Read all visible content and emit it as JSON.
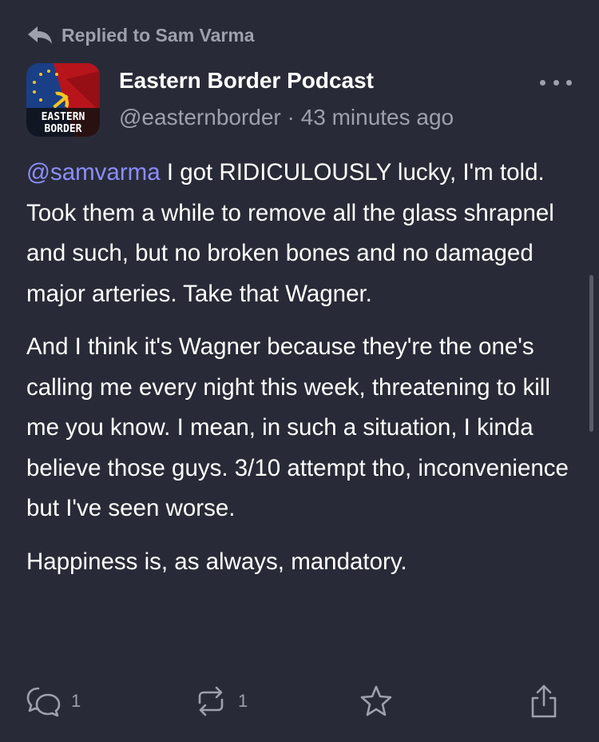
{
  "reply_context": {
    "icon": "reply-arrow-icon",
    "text": "Replied to Sam Varma"
  },
  "author": {
    "display_name": "Eastern Border Podcast",
    "handle": "@easternborder",
    "separator": "·",
    "time_ago": "43 minutes ago",
    "avatar_text_line1": "EASTERN",
    "avatar_text_line2": "BORDER"
  },
  "post": {
    "mention": "@samvarma",
    "paragraph1_rest": " I got RIDICULOUSLY lucky, I'm told. Took them a while to remove all the glass shrapnel and such, but no broken bones and no damaged major arteries. Take that Wagner.",
    "paragraph2": "And I think it's Wagner because they're the one's calling me every night this week, threatening to kill me you know. I mean, in such a situation, I kinda believe those guys. 3/10 attempt tho, inconvenience but I've seen worse.",
    "paragraph3": "Happiness is, as always, mandatory."
  },
  "actions": {
    "reply": {
      "icon": "reply-bubble-icon",
      "count": "1"
    },
    "boost": {
      "icon": "boost-icon",
      "count": "1"
    },
    "favourite": {
      "icon": "star-icon"
    },
    "share": {
      "icon": "share-icon"
    }
  },
  "colors": {
    "background": "#282b37",
    "text": "#ffffff",
    "secondary_text": "#9ea0ad",
    "mention": "#8c8dff"
  }
}
